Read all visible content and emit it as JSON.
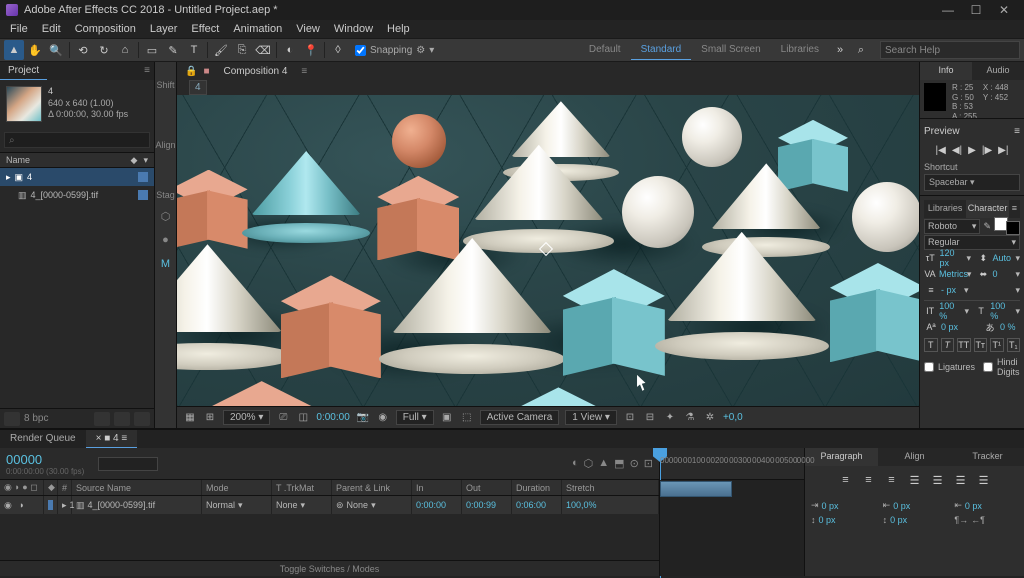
{
  "titlebar": {
    "app": "Adobe After Effects CC 2018 - Untitled Project.aep *"
  },
  "window_buttons": {
    "min": "—",
    "max": "☐",
    "close": "✕"
  },
  "menu": [
    "File",
    "Edit",
    "Composition",
    "Layer",
    "Effect",
    "Animation",
    "View",
    "Window",
    "Help"
  ],
  "toolbar": {
    "snapping_label": "Snapping",
    "workspaces": [
      "Default",
      "Standard",
      "Small Screen",
      "Libraries"
    ],
    "active_workspace": "Standard",
    "search_placeholder": "Search Help"
  },
  "project": {
    "tab": "Project",
    "asset_name": "4",
    "asset_dims": "640 x 640 (1.00)",
    "asset_dur": "Δ 0:00:00, 30.00 fps",
    "search_icon": "⌕",
    "col_name": "Name",
    "rows": [
      {
        "name": "4"
      },
      {
        "name": "4_[0000-0599].tif"
      }
    ]
  },
  "left_labels": [
    "Shift",
    "Align",
    "Stag"
  ],
  "viewer": {
    "tab": "Composition 4",
    "frame_tag": "4",
    "footer": {
      "zoom": "200%",
      "timecode": "0:00:00",
      "res": "Full",
      "camera": "Active Camera",
      "views": "1 View",
      "exposure": "+0,0"
    }
  },
  "info": {
    "tab_info": "Info",
    "tab_audio": "Audio",
    "R": "25",
    "G": "50",
    "B": "53",
    "A": "255",
    "X": "448",
    "Y": "452"
  },
  "preview": {
    "hdr": "Preview",
    "shortcut_hdr": "Shortcut",
    "shortcut": "Spacebar"
  },
  "char": {
    "tab_lib": "Libraries",
    "tab_char": "Character",
    "font": "Roboto",
    "weight": "Regular",
    "size": "120 px",
    "leading": "Auto",
    "kerning": "Metrics",
    "tracking": "0",
    "vscale": "100 %",
    "hscale": "100 %",
    "baseline": "0 px",
    "tsume": "0 %",
    "ligatures": "Ligatures",
    "hindi": "Hindi Digits"
  },
  "timeline": {
    "tab_rq": "Render Queue",
    "tab_comp": "4",
    "playhead": "00000",
    "timecode": "0:00:00:00 (30.00 fps)",
    "cols": {
      "num": "#",
      "src": "Source Name",
      "mode": "Mode",
      "trk": "T .TrkMat",
      "parent": "Parent & Link",
      "in": "In",
      "out": "Out",
      "dur": "Duration",
      "stretch": "Stretch"
    },
    "row": {
      "num": "1",
      "name": "4_[0000-0599].tif",
      "mode": "Normal",
      "trk": "None",
      "in": "0:00:00",
      "out": "0:00:99",
      "dur": "0:06:00",
      "stretch": "100,0%",
      "parent": "None"
    },
    "ruler": [
      "00000",
      "00100",
      "00200",
      "00300",
      "00400",
      "00500",
      "0000"
    ],
    "toggle": "Toggle Switches / Modes"
  },
  "paragraph": {
    "tabs": [
      "Paragraph",
      "Align",
      "Tracker"
    ],
    "indent_l": "0 px",
    "indent_r": "0 px",
    "indent_f": "0 px",
    "space_b": "0 px",
    "space_a": "0 px"
  }
}
